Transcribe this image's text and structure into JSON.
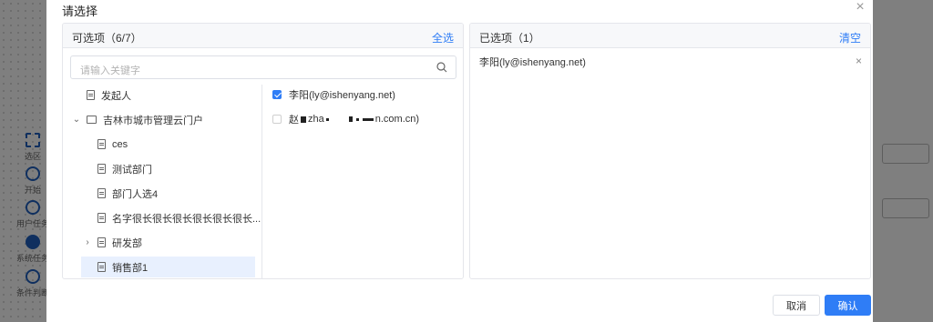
{
  "background": {
    "tools": [
      {
        "label": "选区",
        "icon": "select-icon"
      },
      {
        "label": "开始",
        "icon": "circle-icon"
      },
      {
        "label": "用户任务",
        "icon": "user-icon"
      },
      {
        "label": "系统任务",
        "icon": "gear-icon"
      },
      {
        "label": "条件判断",
        "icon": "diamond-icon"
      }
    ]
  },
  "modal": {
    "title": "请选择",
    "left_panel": {
      "title": "可选项（6/7）",
      "action": "全选",
      "search_placeholder": "请输入关键字",
      "tree": [
        {
          "label": "发起人"
        },
        {
          "label": "吉林市城市管理云门户"
        },
        {
          "label": "ces"
        },
        {
          "label": "测试部门"
        },
        {
          "label": "部门人选4"
        },
        {
          "label": "名字很长很长很长很长很长很长..."
        },
        {
          "label": "研发部"
        },
        {
          "label": "销售部1"
        }
      ],
      "members": [
        {
          "label": "李阳(ly@ishenyang.net)",
          "checked": true
        },
        {
          "label_prefix": "赵",
          "label_mid": "zha",
          "label_suffix": "n.com.cn)",
          "checked": false
        }
      ]
    },
    "right_panel": {
      "title": "已选项（1）",
      "action": "清空",
      "selected": [
        {
          "label": "李阳(ly@ishenyang.net)"
        }
      ]
    },
    "cancel_label": "取消",
    "ok_label": "确认"
  },
  "colors": {
    "accent": "#2f7df6",
    "selected_row": "#e8f0fe",
    "border": "#e5e6eb"
  }
}
